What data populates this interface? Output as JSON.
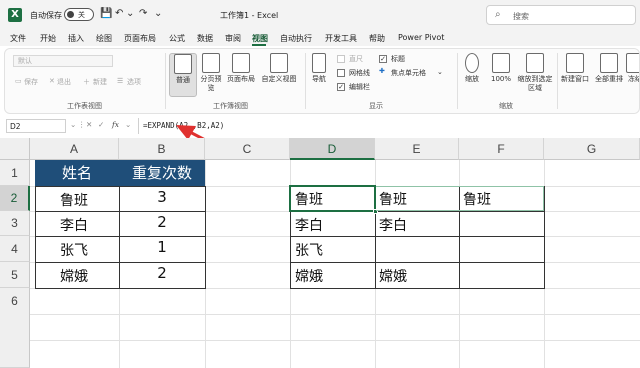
{
  "titlebar": {
    "autosave_label": "自动保存",
    "autosave_state": "关",
    "doc_title": "工作簿1 - Excel",
    "search_placeholder": "搜索"
  },
  "menu": {
    "tabs": [
      "文件",
      "开始",
      "插入",
      "绘图",
      "页面布局",
      "公式",
      "数据",
      "审阅",
      "视图",
      "自动执行",
      "开发工具",
      "帮助",
      "Power Pivot"
    ],
    "active": "视图"
  },
  "ribbon": {
    "sheet_view": {
      "dropdown": "默认",
      "keep": "保存",
      "exit": "退出",
      "new": "新建",
      "options": "选项",
      "group_label": "工作表视图"
    },
    "workbook_view": {
      "normal": "普通",
      "page_break": "分页预览",
      "page_layout": "页面布局",
      "custom": "自定义视图",
      "group_label": "工作簿视图"
    },
    "show": {
      "navigation": "导航",
      "ruler": "直尺",
      "gridlines": "网格线",
      "formula_bar": "编辑栏",
      "headings": "标题",
      "focus_cell": "焦点单元格",
      "group_label": "显示"
    },
    "zoom": {
      "zoom": "缩放",
      "hundred": "100%",
      "to_selection": "缩放到选定区域",
      "group_label": "缩放"
    },
    "window": {
      "new_window": "新建窗口",
      "arrange_all": "全部重排",
      "freeze": "冻结"
    }
  },
  "formula_bar": {
    "name_box": "D2",
    "fx": "fx",
    "formula": "=EXPAND(A2,,B2,A2)"
  },
  "grid": {
    "columns": [
      "A",
      "B",
      "C",
      "D",
      "E",
      "F",
      "G"
    ],
    "rows": [
      "1",
      "2",
      "3",
      "4",
      "5",
      "6"
    ],
    "selected_col": "D",
    "selected_row": "2",
    "source_headers": [
      "姓名",
      "重复次数"
    ],
    "source_names": [
      "鲁班",
      "李白",
      "张飞",
      "嫦娥"
    ],
    "source_counts": [
      "3",
      "2",
      "1",
      "2"
    ],
    "result": [
      [
        "鲁班",
        "鲁班",
        "鲁班"
      ],
      [
        "李白",
        "李白",
        ""
      ],
      [
        "张飞",
        "",
        ""
      ],
      [
        "嫦娥",
        "嫦娥",
        ""
      ]
    ]
  }
}
